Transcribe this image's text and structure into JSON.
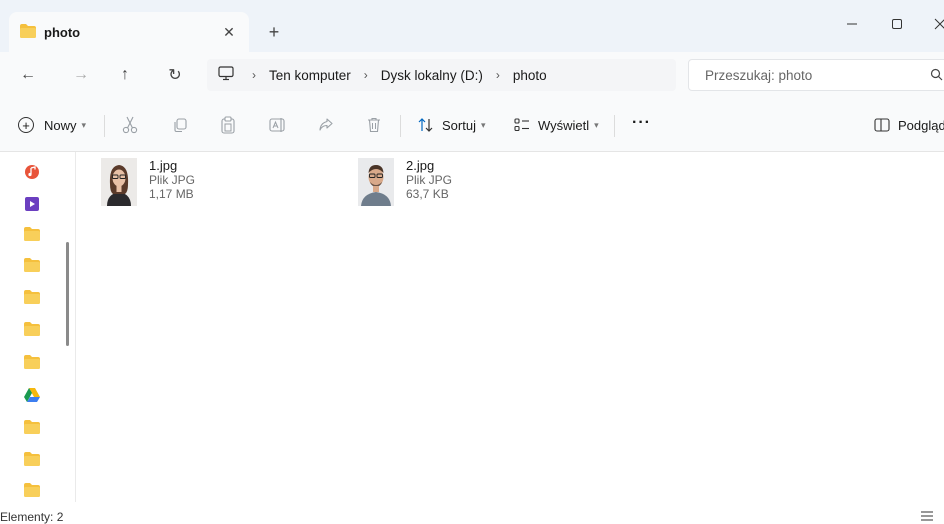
{
  "tab": {
    "title": "photo",
    "close_glyph": "✕",
    "new_tab_glyph": "+"
  },
  "window": {
    "minimize": "–",
    "maximize": "☐",
    "close": "✕"
  },
  "nav": {
    "back": "←",
    "forward": "→",
    "up": "↑",
    "refresh": "↻",
    "breadcrumbs": [
      "Ten komputer",
      "Dysk lokalny (D:)",
      "photo"
    ],
    "separator": "›"
  },
  "search": {
    "placeholder": "Przeszukaj: photo"
  },
  "commands": {
    "new": "Nowy",
    "sort": "Sortuj",
    "view": "Wyświetl",
    "more": "···",
    "preview": "Podgląd"
  },
  "sidebar": {
    "items": [
      {
        "icon": "music-icon"
      },
      {
        "icon": "videos-icon"
      },
      {
        "icon": "folder-icon"
      },
      {
        "icon": "folder-icon"
      },
      {
        "icon": "folder-icon"
      },
      {
        "icon": "folder-icon"
      },
      {
        "icon": "folder-icon"
      },
      {
        "icon": "google-drive-icon"
      },
      {
        "icon": "folder-icon"
      },
      {
        "icon": "folder-icon"
      },
      {
        "icon": "folder-icon"
      }
    ]
  },
  "files": [
    {
      "name": "1.jpg",
      "type": "Plik JPG",
      "size": "1,17 MB"
    },
    {
      "name": "2.jpg",
      "type": "Plik JPG",
      "size": "63,7 KB"
    }
  ],
  "status": {
    "items": "Elementy: 2"
  },
  "colors": {
    "folder": "#f5c03d",
    "accent": "#0067c0",
    "tabbar": "#eef3f9"
  }
}
